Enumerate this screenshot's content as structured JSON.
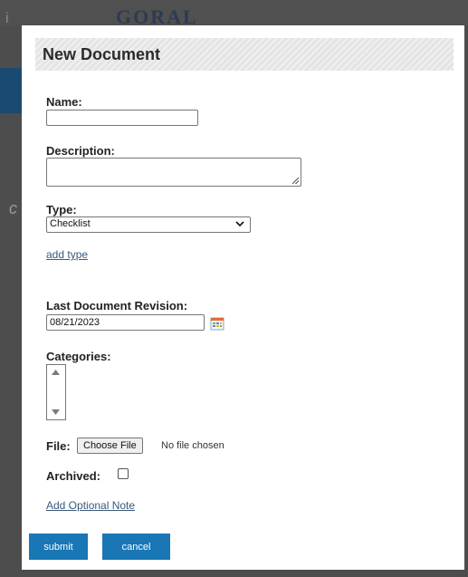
{
  "background": {
    "logo_text": "GORAL",
    "left_char_top": "i",
    "left_char_mid": "c"
  },
  "modal": {
    "title": "New Document",
    "name": {
      "label": "Name:",
      "value": ""
    },
    "description": {
      "label": "Description:",
      "value": ""
    },
    "type": {
      "label": "Type:",
      "selected": "Checklist",
      "add_link": "add type"
    },
    "last_revision": {
      "label": "Last Document Revision:",
      "value": "08/21/2023"
    },
    "categories": {
      "label": "Categories:"
    },
    "file": {
      "label": "File:",
      "button": "Choose File",
      "status": "No file chosen"
    },
    "archived": {
      "label": "Archived:",
      "checked": false
    },
    "optional_note_link": "Add Optional Note",
    "submit_label": "submit",
    "cancel_label": "cancel"
  },
  "colors": {
    "accent_button": "#1977b5",
    "link": "#3a5a7a"
  }
}
